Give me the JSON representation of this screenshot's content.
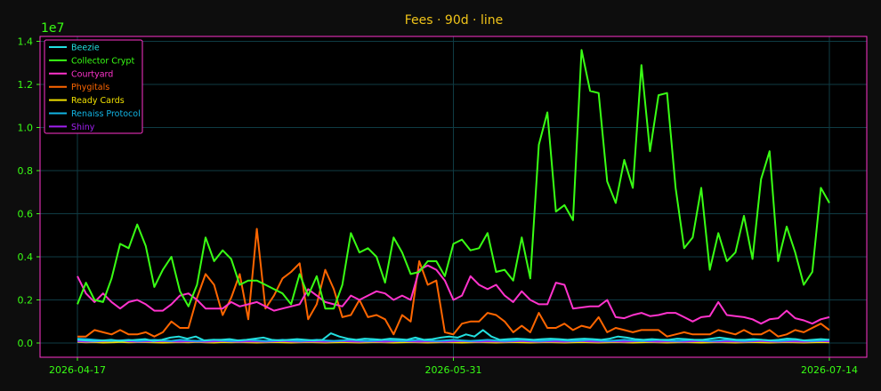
{
  "chart_data": {
    "type": "line",
    "title": "Fees · 90d · line",
    "xlabel": "",
    "ylabel": "",
    "y_multiplier_label": "1e7",
    "x_start": "2026-04-17",
    "x_end": "2026-07-14",
    "x_tick_labels": [
      "2026-04-17",
      "2026-05-31",
      "2026-07-14"
    ],
    "ylim": [
      -0.07,
      1.42
    ],
    "y_ticks": [
      0.0,
      0.2,
      0.4,
      0.6,
      0.8,
      1.0,
      1.2,
      1.4
    ],
    "y_tick_labels": [
      "0.0",
      "0.2",
      "0.4",
      "0.6",
      "0.8",
      "1.0",
      "1.2",
      "1.4"
    ],
    "grid": true,
    "legend_position": "top-left",
    "colors": {
      "background": "#0d0d0d",
      "plot_background": "#000000",
      "frame": "#ff33cc",
      "grid": "#0f3b44",
      "tick_text": "#39ff14",
      "title": "#f0c419"
    },
    "series": [
      {
        "name": "Beezie",
        "color": "#22e0e0",
        "values": [
          0.015,
          0.012,
          0.01,
          0.012,
          0.015,
          0.01,
          0.012,
          0.015,
          0.018,
          0.01,
          0.015,
          0.025,
          0.03,
          0.02,
          0.03,
          0.012,
          0.015,
          0.015,
          0.018,
          0.012,
          0.015,
          0.02,
          0.025,
          0.015,
          0.012,
          0.015,
          0.018,
          0.015,
          0.012,
          0.015,
          0.045,
          0.03,
          0.02,
          0.015,
          0.02,
          0.018,
          0.015,
          0.02,
          0.018,
          0.015,
          0.025,
          0.015,
          0.018,
          0.025,
          0.03,
          0.025,
          0.04,
          0.03,
          0.06,
          0.03,
          0.015,
          0.018,
          0.02,
          0.018,
          0.015,
          0.018,
          0.02,
          0.018,
          0.015,
          0.018,
          0.02,
          0.018,
          0.015,
          0.02,
          0.03,
          0.025,
          0.018,
          0.015,
          0.018,
          0.015,
          0.015,
          0.02,
          0.018,
          0.015,
          0.015,
          0.02,
          0.025,
          0.02,
          0.015,
          0.015,
          0.018,
          0.015,
          0.012,
          0.015,
          0.02,
          0.018,
          0.012,
          0.015,
          0.018,
          0.015
        ]
      },
      {
        "name": "Collector Crypt",
        "color": "#39ff14",
        "values": [
          0.18,
          0.28,
          0.2,
          0.19,
          0.3,
          0.46,
          0.44,
          0.55,
          0.45,
          0.26,
          0.34,
          0.4,
          0.24,
          0.17,
          0.27,
          0.49,
          0.38,
          0.43,
          0.39,
          0.27,
          0.29,
          0.29,
          0.27,
          0.25,
          0.23,
          0.18,
          0.32,
          0.22,
          0.31,
          0.16,
          0.16,
          0.27,
          0.51,
          0.42,
          0.44,
          0.4,
          0.28,
          0.49,
          0.42,
          0.32,
          0.33,
          0.38,
          0.38,
          0.31,
          0.46,
          0.48,
          0.43,
          0.44,
          0.51,
          0.33,
          0.34,
          0.29,
          0.49,
          0.3,
          0.92,
          1.07,
          0.61,
          0.64,
          0.57,
          1.36,
          1.17,
          1.16,
          0.75,
          0.65,
          0.85,
          0.72,
          1.29,
          0.89,
          1.15,
          1.16,
          0.72,
          0.44,
          0.49,
          0.72,
          0.34,
          0.51,
          0.38,
          0.42,
          0.59,
          0.39,
          0.76,
          0.89,
          0.38,
          0.54,
          0.42,
          0.27,
          0.33,
          0.72,
          0.65
        ]
      },
      {
        "name": "Courtyard",
        "color": "#ff33cc",
        "values": [
          0.31,
          0.23,
          0.19,
          0.23,
          0.19,
          0.16,
          0.19,
          0.2,
          0.18,
          0.15,
          0.15,
          0.18,
          0.22,
          0.23,
          0.2,
          0.16,
          0.16,
          0.16,
          0.19,
          0.17,
          0.18,
          0.19,
          0.17,
          0.15,
          0.16,
          0.17,
          0.18,
          0.25,
          0.22,
          0.19,
          0.18,
          0.17,
          0.22,
          0.2,
          0.22,
          0.24,
          0.23,
          0.2,
          0.22,
          0.2,
          0.34,
          0.36,
          0.34,
          0.29,
          0.2,
          0.22,
          0.31,
          0.27,
          0.25,
          0.27,
          0.22,
          0.19,
          0.24,
          0.2,
          0.18,
          0.18,
          0.28,
          0.27,
          0.16,
          0.165,
          0.17,
          0.17,
          0.2,
          0.12,
          0.115,
          0.13,
          0.14,
          0.125,
          0.13,
          0.14,
          0.14,
          0.12,
          0.1,
          0.12,
          0.125,
          0.19,
          0.13,
          0.125,
          0.12,
          0.11,
          0.09,
          0.11,
          0.115,
          0.15,
          0.115,
          0.105,
          0.09,
          0.11,
          0.12
        ]
      },
      {
        "name": "Phygitals",
        "color": "#ff6600",
        "values": [
          0.03,
          0.03,
          0.06,
          0.05,
          0.04,
          0.06,
          0.04,
          0.04,
          0.05,
          0.03,
          0.05,
          0.1,
          0.07,
          0.07,
          0.21,
          0.32,
          0.27,
          0.13,
          0.21,
          0.32,
          0.11,
          0.53,
          0.16,
          0.22,
          0.3,
          0.33,
          0.37,
          0.11,
          0.18,
          0.34,
          0.25,
          0.12,
          0.13,
          0.2,
          0.12,
          0.13,
          0.11,
          0.04,
          0.13,
          0.1,
          0.38,
          0.27,
          0.29,
          0.05,
          0.04,
          0.09,
          0.1,
          0.1,
          0.14,
          0.13,
          0.1,
          0.05,
          0.08,
          0.05,
          0.14,
          0.07,
          0.07,
          0.09,
          0.06,
          0.08,
          0.07,
          0.12,
          0.05,
          0.07,
          0.06,
          0.05,
          0.06,
          0.06,
          0.06,
          0.03,
          0.04,
          0.05,
          0.04,
          0.04,
          0.04,
          0.06,
          0.05,
          0.04,
          0.06,
          0.04,
          0.04,
          0.06,
          0.03,
          0.04,
          0.06,
          0.05,
          0.07,
          0.09,
          0.06
        ]
      },
      {
        "name": "Ready Cards",
        "color": "#f0e000",
        "values": [
          0.005,
          0.003,
          0.004,
          0.002,
          0.003,
          0.005,
          0.003,
          0.004,
          0.004,
          0.003,
          0.002,
          0.003,
          0.004,
          0.003,
          0.005,
          0.003,
          0.002,
          0.004,
          0.003,
          0.004,
          0.003,
          0.002,
          0.003,
          0.004,
          0.003,
          0.002,
          0.003,
          0.004,
          0.003,
          0.002,
          0.003,
          0.004,
          0.003,
          0.002,
          0.003,
          0.004,
          0.003,
          0.002,
          0.003,
          0.004,
          0.003,
          0.002,
          0.003,
          0.004,
          0.003,
          0.002,
          0.003,
          0.004,
          0.003,
          0.002,
          0.003,
          0.004,
          0.003,
          0.002,
          0.003,
          0.004,
          0.003,
          0.002,
          0.003,
          0.004,
          0.003,
          0.002,
          0.003,
          0.004,
          0.003,
          0.002,
          0.003,
          0.004,
          0.003,
          0.002,
          0.003,
          0.004,
          0.003,
          0.002,
          0.003,
          0.004,
          0.003,
          0.002,
          0.003,
          0.004,
          0.003,
          0.002,
          0.003,
          0.004,
          0.003,
          0.002,
          0.003,
          0.004,
          0.003
        ]
      },
      {
        "name": "Renaiss Protocol",
        "color": "#12b5e5",
        "values": [
          0.02,
          0.018,
          0.015,
          0.012,
          0.01,
          0.012,
          0.015,
          0.01,
          0.012,
          0.015,
          0.012,
          0.01,
          0.015,
          0.012,
          0.01,
          0.012,
          0.015,
          0.012,
          0.01,
          0.012,
          0.015,
          0.012,
          0.01,
          0.012,
          0.015,
          0.012,
          0.01,
          0.012,
          0.015,
          0.012,
          0.01,
          0.012,
          0.015,
          0.012,
          0.01,
          0.012,
          0.015,
          0.012,
          0.01,
          0.012,
          0.015,
          0.012,
          0.01,
          0.012,
          0.015,
          0.012,
          0.01,
          0.012,
          0.015,
          0.012,
          0.01,
          0.012,
          0.015,
          0.012,
          0.01,
          0.012,
          0.015,
          0.012,
          0.01,
          0.012,
          0.015,
          0.012,
          0.01,
          0.012,
          0.015,
          0.012,
          0.01,
          0.012,
          0.015,
          0.012,
          0.01,
          0.012,
          0.015,
          0.012,
          0.01,
          0.012,
          0.015,
          0.012,
          0.01,
          0.012,
          0.015,
          0.012,
          0.01,
          0.012,
          0.015,
          0.012,
          0.01,
          0.012,
          0.015
        ]
      },
      {
        "name": "Shiny",
        "color": "#a020f0",
        "values": [
          0.008,
          0.006,
          0.007,
          0.009,
          0.01,
          0.012,
          0.008,
          0.006,
          0.007,
          0.008,
          0.009,
          0.007,
          0.006,
          0.008,
          0.007,
          0.006,
          0.008,
          0.009,
          0.007,
          0.006,
          0.008,
          0.007,
          0.006,
          0.008,
          0.009,
          0.007,
          0.006,
          0.008,
          0.007,
          0.006,
          0.008,
          0.009,
          0.007,
          0.006,
          0.008,
          0.007,
          0.006,
          0.008,
          0.009,
          0.007,
          0.006,
          0.008,
          0.007,
          0.006,
          0.008,
          0.009,
          0.007,
          0.006,
          0.008,
          0.007,
          0.006,
          0.008,
          0.009,
          0.007,
          0.006,
          0.008,
          0.007,
          0.006,
          0.008,
          0.009,
          0.007,
          0.006,
          0.008,
          0.007,
          0.006,
          0.008,
          0.009,
          0.007,
          0.006,
          0.008,
          0.007,
          0.006,
          0.008,
          0.009,
          0.007,
          0.006,
          0.008,
          0.007,
          0.006,
          0.008,
          0.009,
          0.007,
          0.006,
          0.008,
          0.007,
          0.006,
          0.008,
          0.009,
          0.007
        ]
      }
    ]
  }
}
